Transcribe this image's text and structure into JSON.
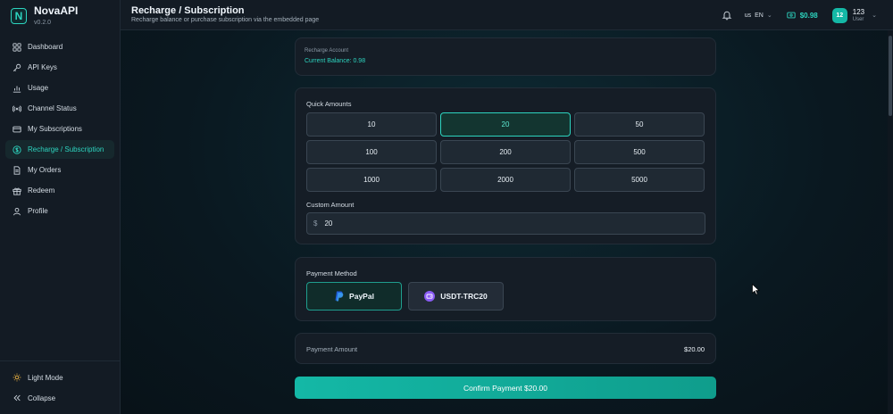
{
  "brand": {
    "name": "NovaAPI",
    "version": "v0.2.0",
    "logo_letter": "N"
  },
  "sidebar": {
    "items": [
      {
        "label": "Dashboard",
        "icon": "grid-icon"
      },
      {
        "label": "API Keys",
        "icon": "key-icon"
      },
      {
        "label": "Usage",
        "icon": "bar-chart-icon"
      },
      {
        "label": "Channel Status",
        "icon": "broadcast-icon"
      },
      {
        "label": "My Subscriptions",
        "icon": "card-icon"
      },
      {
        "label": "Recharge / Subscription",
        "icon": "dollar-circle-icon",
        "active": true
      },
      {
        "label": "My Orders",
        "icon": "document-icon"
      },
      {
        "label": "Redeem",
        "icon": "gift-icon"
      },
      {
        "label": "Profile",
        "icon": "user-icon"
      }
    ],
    "bottom": {
      "theme_label": "Light Mode",
      "collapse_label": "Collapse"
    }
  },
  "header": {
    "title": "Recharge / Subscription",
    "subtitle": "Recharge balance or purchase subscription via the embedded page",
    "lang_flag": "us",
    "lang_code": "EN",
    "balance": "$0.98",
    "user": {
      "avatar_text": "12",
      "name": "123",
      "role": "User"
    }
  },
  "account": {
    "label": "Recharge Account",
    "balance_text": "Current Balance: 0.98"
  },
  "amounts": {
    "label": "Quick Amounts",
    "options": [
      "10",
      "20",
      "50",
      "100",
      "200",
      "500",
      "1000",
      "2000",
      "5000"
    ],
    "selected": "20",
    "custom_label": "Custom Amount",
    "currency_symbol": "$",
    "custom_value": "20"
  },
  "payment": {
    "label": "Payment Method",
    "methods": [
      {
        "name": "PayPal",
        "icon": "paypal-icon",
        "selected": true
      },
      {
        "name": "USDT-TRC20",
        "icon": "wallet-icon",
        "selected": false
      }
    ]
  },
  "summary": {
    "label": "Payment Amount",
    "value": "$20.00"
  },
  "confirm_label": "Confirm Payment $20.00",
  "colors": {
    "accent": "#2dd4bf",
    "background": "#0c1a22",
    "card": "#151d26"
  }
}
